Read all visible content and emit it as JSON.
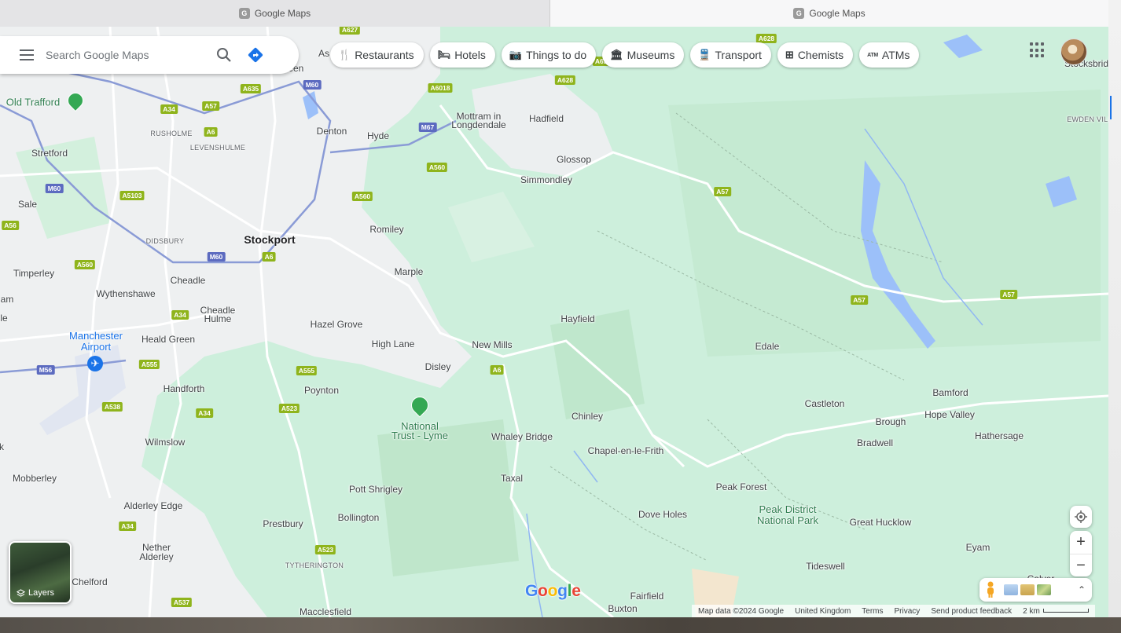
{
  "browser": {
    "tabs": [
      {
        "label": "Google Maps",
        "favicon": "G"
      },
      {
        "label": "Google Maps",
        "favicon": "G"
      }
    ]
  },
  "search": {
    "placeholder": "Search Google Maps"
  },
  "chips": [
    {
      "label": "Restaurants",
      "icon": "🍴"
    },
    {
      "label": "Hotels",
      "icon": "🛏"
    },
    {
      "label": "Things to do",
      "icon": "📷"
    },
    {
      "label": "Museums",
      "icon": "🏛"
    },
    {
      "label": "Transport",
      "icon": "🚆"
    },
    {
      "label": "Chemists",
      "icon": "⊞"
    },
    {
      "label": "ATMs",
      "icon": "ATM"
    }
  ],
  "places": {
    "stockport": "Stockport",
    "old_trafford": "Old Trafford",
    "stretford": "Stretford",
    "rusholme": "RUSHOLME",
    "levenshulme": "LEVENSHULME",
    "denton": "Denton",
    "hyde": "Hyde",
    "mottram": "Mottram in",
    "mottram2": "Longdendale",
    "hadfield": "Hadfield",
    "glossop": "Glossop",
    "simmondley": "Simmondley",
    "sale": "Sale",
    "didsbury": "DIDSBURY",
    "romiley": "Romiley",
    "marple": "Marple",
    "timperley": "Timperley",
    "cheadle": "Cheadle",
    "wythenshawe": "Wythenshawe",
    "cheadle_hulme": "Cheadle",
    "cheadle_hulme2": "Hulme",
    "hazel_grove": "Hazel Grove",
    "high_lane": "High Lane",
    "new_mills": "New Mills",
    "hayfield": "Hayfield",
    "manchester_airport": "Manchester",
    "manchester_airport2": "Airport",
    "heald_green": "Heald Green",
    "disley": "Disley",
    "edale": "Edale",
    "handforth": "Handforth",
    "poynton": "Poynton",
    "national_trust": "National",
    "national_trust2": "Trust - Lyme",
    "chinley": "Chinley",
    "castleton": "Castleton",
    "bamford": "Bamford",
    "hope_valley": "Hope Valley",
    "brough": "Brough",
    "hathersage": "Hathersage",
    "wilmslow": "Wilmslow",
    "whaley_bridge": "Whaley Bridge",
    "chapel": "Chapel-en-le-Frith",
    "bradwell": "Bradwell",
    "mobberley": "Mobberley",
    "taxal": "Taxal",
    "peak_forest": "Peak Forest",
    "pott_shrigley": "Pott Shrigley",
    "alderley_edge": "Alderley Edge",
    "peak_district": "Peak District",
    "peak_district2": "National Park",
    "dove_holes": "Dove Holes",
    "bollington": "Bollington",
    "great_hucklow": "Great Hucklow",
    "prestbury": "Prestbury",
    "nether_alderley": "Nether",
    "nether_alderley2": "Alderley",
    "eyam": "Eyam",
    "tytherington": "TYTHERINGTON",
    "tideswell": "Tideswell",
    "chelford": "Chelford",
    "fairfield": "Fairfield",
    "calver": "Calver",
    "buxton": "Buxton",
    "macclesfield": "Macclesfield",
    "stocksbridge": "Stocksbrid",
    "ewden": "EWDEN VILL",
    "as": "As",
    "ieen": "ieen",
    "am": "am",
    "le": "le",
    "k": "k"
  },
  "roads": {
    "a627": "A627",
    "a628a": "A628",
    "a628b": "A628",
    "a628c": "A628",
    "m60a": "M60",
    "a635": "A635",
    "a57a": "A57",
    "a34a": "A34",
    "a6a": "A6",
    "a6018": "A6018",
    "m67": "M67",
    "a560a": "A560",
    "a560b": "A560",
    "a57b": "A57",
    "m60b": "M60",
    "a5103": "A5103",
    "a56": "A56",
    "m60c": "M60",
    "a6b": "A6",
    "a560c": "A560",
    "a57c": "A57",
    "a57d": "A57",
    "a34b": "A34",
    "a555a": "A555",
    "a555b": "A555",
    "a6c": "A6",
    "m56": "M56",
    "a538": "A538",
    "a34c": "A34",
    "a523a": "A523",
    "a34d": "A34",
    "a523b": "A523",
    "a537": "A537"
  },
  "controls": {
    "layers_label": "Layers",
    "zoom_in": "+",
    "zoom_out": "−",
    "expand": "⌃"
  },
  "logo": {
    "letters": [
      "G",
      "o",
      "o",
      "g",
      "l",
      "e"
    ],
    "colors": [
      "#4285f4",
      "#ea4335",
      "#fbbc05",
      "#4285f4",
      "#34a853",
      "#ea4335"
    ]
  },
  "footer": {
    "map_data": "Map data ©2024 Google",
    "region": "United Kingdom",
    "terms": "Terms",
    "privacy": "Privacy",
    "feedback": "Send product feedback",
    "scale": "2 km"
  },
  "colors": {
    "accent": "#1a73e8",
    "park_green": "#cdefdc",
    "urban": "#f1f3f4"
  }
}
